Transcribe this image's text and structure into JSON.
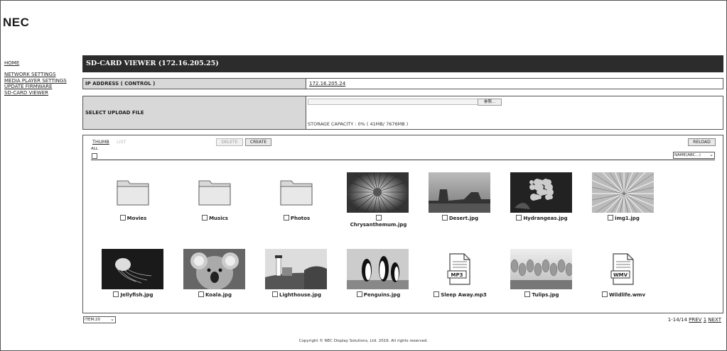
{
  "brand": "NEC",
  "nav": {
    "home": "HOME",
    "network_settings": "NETWORK SETTINGS",
    "media_player_settings": "MEDIA PLAYER SETTINGS",
    "update_firmware": "UPDATE FIRMWARE",
    "sd_card_viewer": "SD-CARD VIEWER"
  },
  "title": "SD-CARD VIEWER (172.16.205.25)",
  "ip_row": {
    "label": "IP ADDRESS ( CONTROL )",
    "value": "172.16.205.24"
  },
  "upload_row": {
    "label": "SELECT UPLOAD FILE",
    "browse_label": "参照...",
    "storage": "STORAGE CAPACITY : 0% ( 41MB/ 7676MB )"
  },
  "toolbar": {
    "thumb": "THUMB",
    "list": "LIST",
    "delete": "DELETE",
    "create": "CREATE",
    "reload": "RELOAD",
    "all": "ALL",
    "sort": "NAME(ABC...)"
  },
  "files": [
    {
      "name": "Movies",
      "kind": "folder-icon"
    },
    {
      "name": "Musics",
      "kind": "folder-icon"
    },
    {
      "name": "Photos",
      "kind": "folder-icon"
    },
    {
      "name": "Chrysanthemum.jpg",
      "kind": "photo-thumbnail"
    },
    {
      "name": "Desert.jpg",
      "kind": "photo-thumbnail"
    },
    {
      "name": "Hydrangeas.jpg",
      "kind": "photo-thumbnail"
    },
    {
      "name": "img1.jpg",
      "kind": "photo-thumbnail"
    },
    {
      "name": "Jellyfish.jpg",
      "kind": "photo-thumbnail"
    },
    {
      "name": "Koala.jpg",
      "kind": "photo-thumbnail"
    },
    {
      "name": "Lighthouse.jpg",
      "kind": "photo-thumbnail"
    },
    {
      "name": "Penguins.jpg",
      "kind": "photo-thumbnail"
    },
    {
      "name": "Sleep Away.mp3",
      "kind": "mp3-file-icon",
      "badge": "MP3"
    },
    {
      "name": "Tulips.jpg",
      "kind": "photo-thumbnail"
    },
    {
      "name": "Wildlife.wmv",
      "kind": "wmv-file-icon",
      "badge": "WMV"
    }
  ],
  "footer": {
    "items_select": "ITEM:20",
    "range": "1-14/14",
    "prev": "PREV",
    "page": "1",
    "next": "NEXT",
    "copyright": "Copyright © NEC Display Solutions, Ltd. 2016. All rights reserved."
  }
}
